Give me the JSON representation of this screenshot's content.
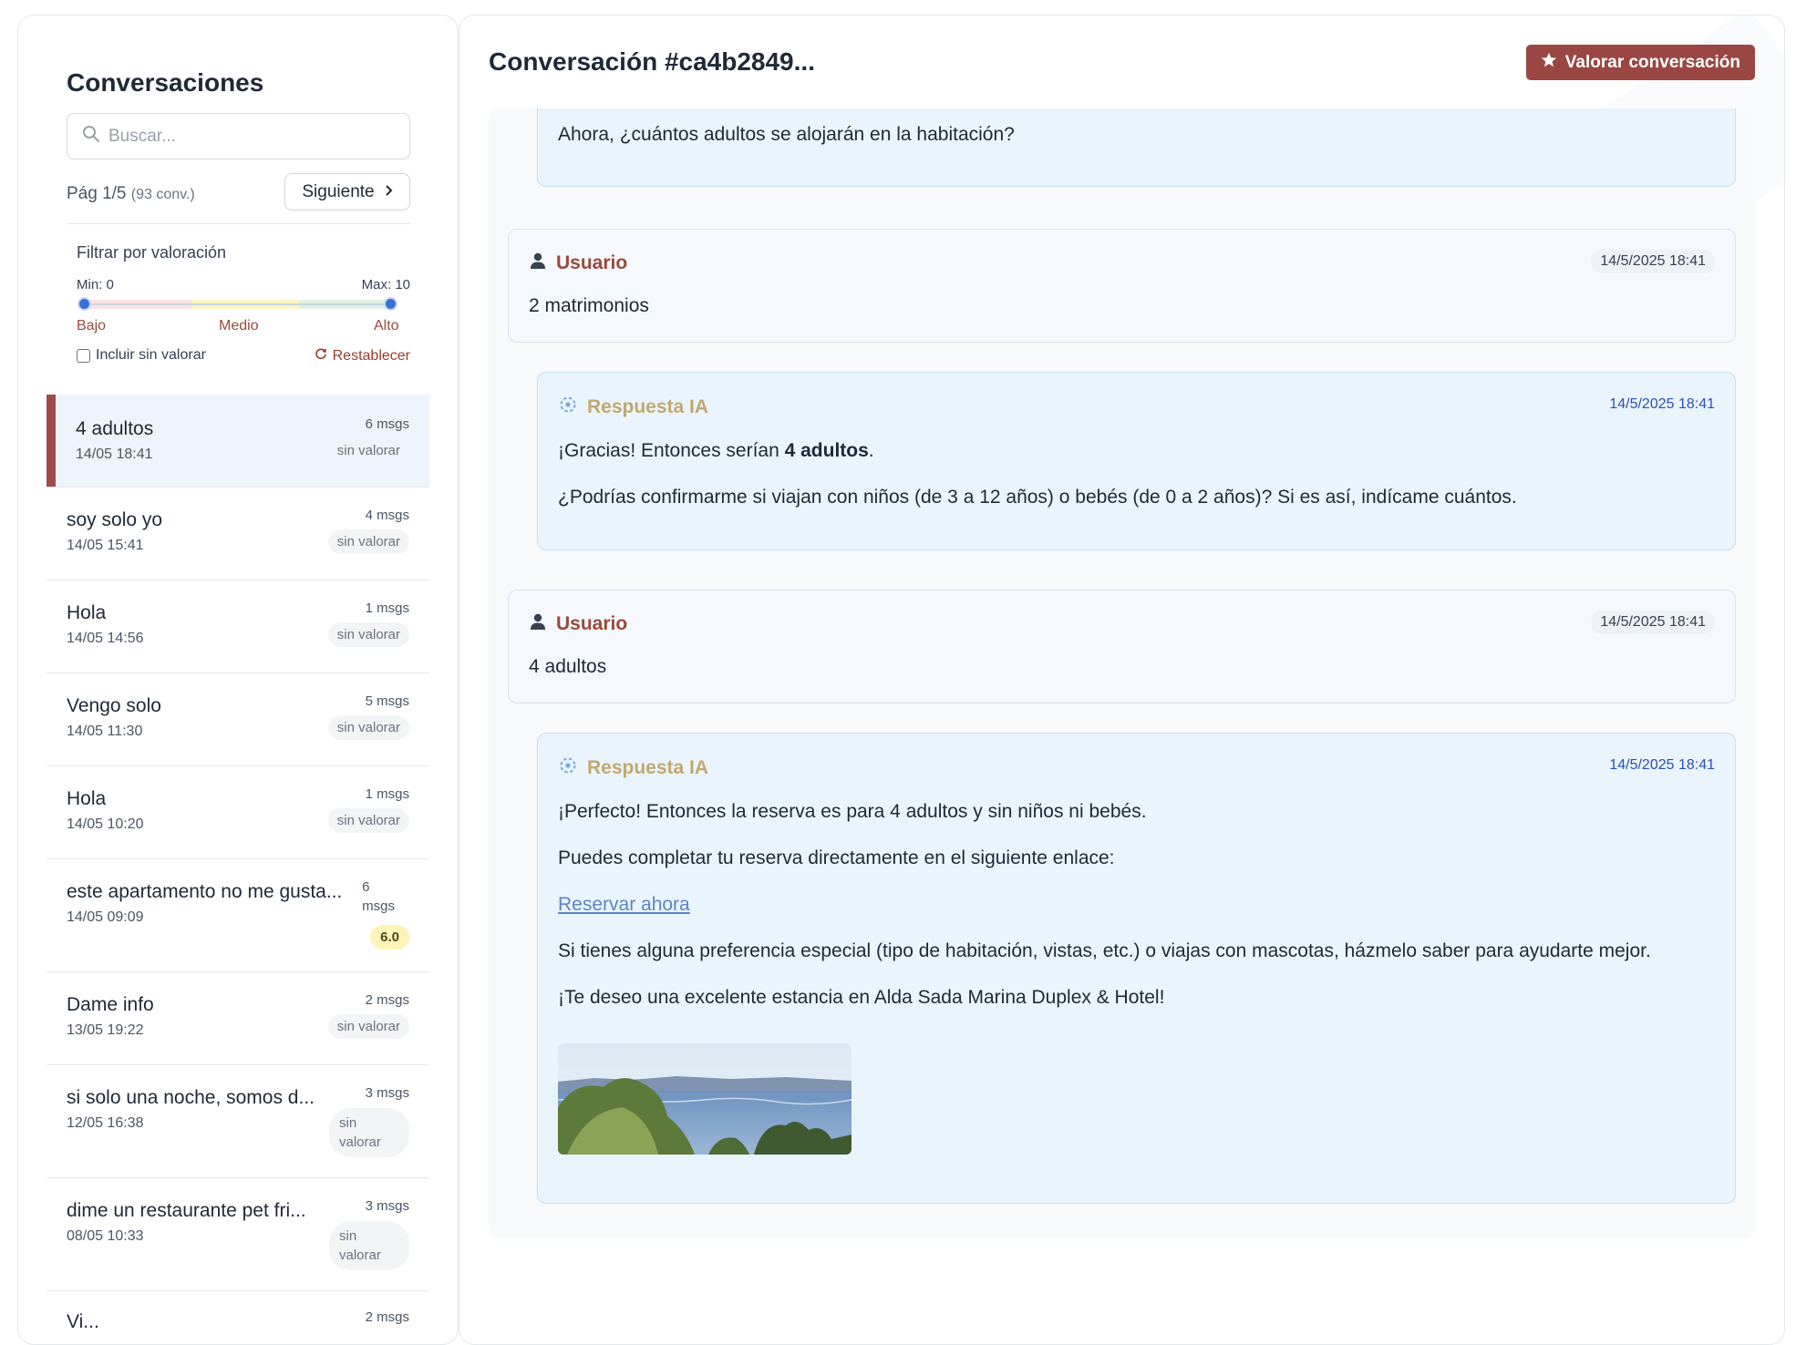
{
  "sidebar": {
    "title": "Conversaciones",
    "search_placeholder": "Buscar...",
    "pager_text": "Pág 1/5",
    "pager_count": "(93 conv.)",
    "next_label": "Siguiente",
    "filter": {
      "title": "Filtrar por valoración",
      "min_label": "Min: 0",
      "max_label": "Max: 10",
      "min_value": 0,
      "max_value": 10,
      "low": "Bajo",
      "mid": "Medio",
      "high": "Alto",
      "include_unrated": "Incluir sin valorar",
      "reset": "Restablecer"
    },
    "conversations": [
      {
        "title": "4 adultos",
        "date": "14/05 18:41",
        "msgs": "6 msgs",
        "badge": "sin valorar"
      },
      {
        "title": "soy solo yo",
        "date": "14/05 15:41",
        "msgs": "4 msgs",
        "badge": "sin valorar"
      },
      {
        "title": "Hola",
        "date": "14/05 14:56",
        "msgs": "1 msgs",
        "badge": "sin valorar"
      },
      {
        "title": "Vengo solo",
        "date": "14/05 11:30",
        "msgs": "5 msgs",
        "badge": "sin valorar"
      },
      {
        "title": "Hola",
        "date": "14/05 10:20",
        "msgs": "1 msgs",
        "badge": "sin valorar"
      },
      {
        "title": "este apartamento no me gusta...",
        "date": "14/05 09:09",
        "msgs_num": "6",
        "msgs_word": "msgs",
        "score": "6.0"
      },
      {
        "title": "Dame info",
        "date": "13/05 19:22",
        "msgs": "2 msgs",
        "badge": "sin valorar"
      },
      {
        "title": "si solo una noche, somos d...",
        "date": "12/05 16:38",
        "msgs": "3 msgs",
        "badge_l1": "sin",
        "badge_l2": "valorar"
      },
      {
        "title": "dime un restaurante pet fri...",
        "date": "08/05 10:33",
        "msgs": "3 msgs",
        "badge_l1": "sin",
        "badge_l2": "valorar"
      },
      {
        "title": "Vi...",
        "msgs": "2 msgs"
      }
    ]
  },
  "main": {
    "title": "Conversación #ca4b2849...",
    "rate_button": "Valorar conversación",
    "messages": [
      {
        "role": "ai",
        "lines": [
          "Ahora, ¿cuántos adultos se alojarán en la habitación?"
        ]
      },
      {
        "role": "user",
        "author": "Usuario",
        "time": "14/5/2025 18:41",
        "lines": [
          "2 matrimonios"
        ]
      },
      {
        "role": "ai",
        "author": "Respuesta IA",
        "time": "14/5/2025 18:41",
        "line1_pre": "¡Gracias! Entonces serían ",
        "line1_bold": "4 adultos",
        "line1_post": ".",
        "line2": "¿Podrías confirmarme si viajan con niños (de 3 a 12 años) o bebés (de 0 a 2 años)? Si es así, indícame cuántos."
      },
      {
        "role": "user",
        "author": "Usuario",
        "time": "14/5/2025 18:41",
        "lines": [
          "4 adultos"
        ]
      },
      {
        "role": "ai",
        "author": "Respuesta IA",
        "time": "14/5/2025 18:41",
        "lines": [
          "¡Perfecto! Entonces la reserva es para 4 adultos y sin niños ni bebés.",
          "Puedes completar tu reserva directamente en el siguiente enlace:",
          "Reservar ahora",
          "Si tienes alguna preferencia especial (tipo de habitación, vistas, etc.) o viajas con mascotas, házmelo saber para ayudarte mejor.",
          "¡Te deseo una excelente estancia en Alda Sada Marina Duplex & Hotel!"
        ]
      }
    ]
  },
  "colors": {
    "accent": "#9a4743",
    "user_author": "#9a4a3a",
    "ai_author": "#c2a86e",
    "ai_time": "#2951b5",
    "link": "#5a86c6"
  },
  "icons": [
    "search-icon",
    "chevron-right-icon",
    "refresh-icon",
    "star-icon",
    "user-icon",
    "ai-sparkle-icon",
    "checkbox-icon"
  ]
}
